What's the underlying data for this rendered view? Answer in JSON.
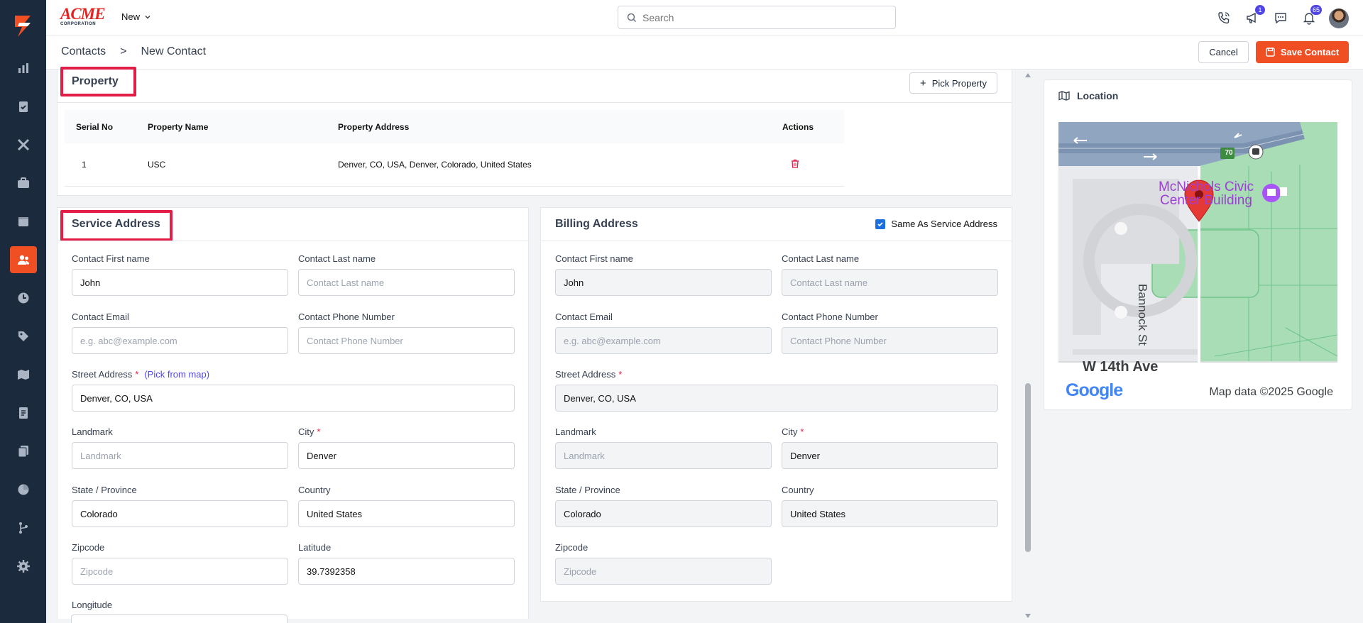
{
  "brand": {
    "logo_text": "ACME",
    "logo_subtext": "CORPORATION",
    "accent_color": "#f04e23",
    "sidebar_color": "#1b2a3d"
  },
  "sidebar": {
    "items": [
      {
        "icon": "bar-chart-icon"
      },
      {
        "icon": "clipboard-check-icon"
      },
      {
        "icon": "tools-icon"
      },
      {
        "icon": "briefcase-icon"
      },
      {
        "icon": "calendar-icon"
      },
      {
        "icon": "contacts-icon",
        "active": true
      },
      {
        "icon": "clock-icon"
      },
      {
        "icon": "tag-icon"
      },
      {
        "icon": "map-icon"
      },
      {
        "icon": "invoice-icon"
      },
      {
        "icon": "documents-icon"
      },
      {
        "icon": "pie-chart-icon"
      },
      {
        "icon": "workflow-icon"
      },
      {
        "icon": "settings-icon"
      }
    ]
  },
  "topbar": {
    "new_label": "New",
    "search_placeholder": "Search",
    "announce_badge": "1",
    "notif_badge": "65"
  },
  "header": {
    "breadcrumb_root": "Contacts",
    "breadcrumb_sep": ">",
    "breadcrumb_current": "New Contact",
    "cancel_label": "Cancel",
    "save_label": "Save Contact"
  },
  "property": {
    "title": "Property",
    "pick_label": "Pick Property",
    "columns": [
      "Serial No",
      "Property Name",
      "Property Address",
      "Actions"
    ],
    "rows": [
      {
        "serial": "1",
        "name": "USC",
        "address": "Denver, CO, USA, Denver, Colorado, United States"
      }
    ]
  },
  "service": {
    "title": "Service Address",
    "first_name_label": "Contact First name",
    "first_name_value": "John",
    "last_name_label": "Contact Last name",
    "last_name_placeholder": "Contact Last name",
    "email_label": "Contact Email",
    "email_placeholder": "e.g. abc@example.com",
    "phone_label": "Contact Phone Number",
    "phone_placeholder": "Contact Phone Number",
    "street_label": "Street Address",
    "req": "*",
    "pick_from_map": "(Pick from map)",
    "street_value": "Denver, CO, USA",
    "landmark_label": "Landmark",
    "landmark_placeholder": "Landmark",
    "city_label": "City",
    "city_value": "Denver",
    "state_label": "State / Province",
    "state_value": "Colorado",
    "country_label": "Country",
    "country_value": "United States",
    "zip_label": "Zipcode",
    "zip_placeholder": "Zipcode",
    "lat_label": "Latitude",
    "lat_value": "39.7392358",
    "lng_label": "Longitude"
  },
  "billing": {
    "title": "Billing Address",
    "same_as_label": "Same As Service Address",
    "same_as_checked": true,
    "first_name_label": "Contact First name",
    "first_name_value": "John",
    "last_name_label": "Contact Last name",
    "last_name_placeholder": "Contact Last name",
    "email_label": "Contact Email",
    "email_placeholder": "e.g. abc@example.com",
    "phone_label": "Contact Phone Number",
    "phone_placeholder": "Contact Phone Number",
    "street_label": "Street Address",
    "req": "*",
    "street_value": "Denver, CO, USA",
    "landmark_label": "Landmark",
    "landmark_placeholder": "Landmark",
    "city_label": "City",
    "city_value": "Denver",
    "state_label": "State / Province",
    "state_value": "Colorado",
    "country_label": "Country",
    "country_value": "United States",
    "zip_label": "Zipcode",
    "zip_placeholder": "Zipcode"
  },
  "location": {
    "title": "Location",
    "map_place_line1": "McNichols Civic",
    "map_place_line2": "Center Building",
    "map_street": "Bannock St",
    "map_avenue": "W 14th Ave",
    "map_highway": "70",
    "map_google": "Google",
    "map_attribution": "Map data ©2025 Google"
  }
}
